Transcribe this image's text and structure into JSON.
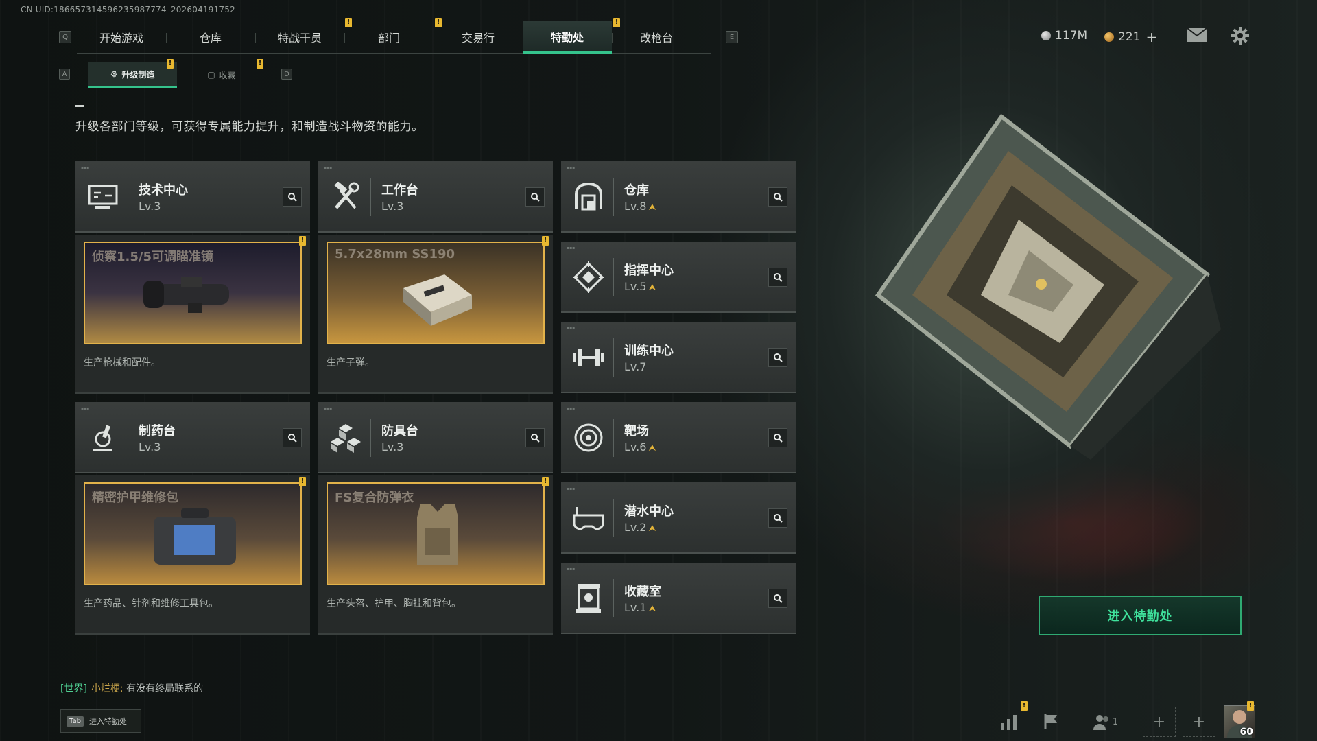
{
  "uid": "CN UID:18665731459623598777​4_202604191752",
  "nav": {
    "key_left": "Q",
    "key_right": "E",
    "tabs": [
      "开始游戏",
      "仓库",
      "特战干员",
      "部门",
      "交易行",
      "特勤处",
      "改枪台"
    ],
    "active": "特勤处"
  },
  "currency": {
    "silver": "117M",
    "gold": "221",
    "gold_add": "+"
  },
  "subnav": {
    "key_left": "A",
    "key_right": "D",
    "tabs": [
      "升级制造",
      "收藏"
    ],
    "active": "升级制造"
  },
  "description": "升级各部门等级，可获得专属能力提升，和制造战斗物资的能力。",
  "departments": [
    {
      "name": "技术中心",
      "level": "Lv.3",
      "upgradable": false,
      "icon": "monitor-icon"
    },
    {
      "name": "工作台",
      "level": "Lv.3",
      "upgradable": false,
      "icon": "wrench-hammer-icon"
    },
    {
      "name": "仓库",
      "level": "Lv.8",
      "upgradable": true,
      "icon": "warehouse-icon"
    },
    {
      "name": "指挥中心",
      "level": "Lv.5",
      "upgradable": true,
      "icon": "command-diamond-icon"
    },
    {
      "name": "训练中心",
      "level": "Lv.7",
      "upgradable": false,
      "icon": "dumbbell-icon"
    },
    {
      "name": "制药台",
      "level": "Lv.3",
      "upgradable": false,
      "icon": "microscope-icon"
    },
    {
      "name": "防具台",
      "level": "Lv.3",
      "upgradable": false,
      "icon": "cubes-icon"
    },
    {
      "name": "靶场",
      "level": "Lv.6",
      "upgradable": true,
      "icon": "target-icon"
    },
    {
      "name": "潜水中心",
      "level": "Lv.2",
      "upgradable": true,
      "icon": "diving-mask-icon"
    },
    {
      "name": "收藏室",
      "level": "Lv.1",
      "upgradable": true,
      "icon": "display-case-icon"
    }
  ],
  "productions": [
    {
      "item": "侦察1.5/5可调瞄准镜",
      "desc": "生产枪械和配件。"
    },
    {
      "item": "5.7x28mm SS190",
      "desc": "生产子弹。"
    },
    {
      "item": "精密护甲维修包",
      "desc": "生产药品、针剂和维修工具包。"
    },
    {
      "item": "FS复合防弹衣",
      "desc": "生产头盔、护甲、胸挂和背包。"
    }
  ],
  "enter_button": "进入特勤处",
  "chat": {
    "channel": "[世界]",
    "nick": "小烂梗:",
    "message": "有没有终局联系的"
  },
  "tab_hint": {
    "key": "Tab",
    "label": "进入特勤处"
  },
  "bottom": {
    "friends_count": "1",
    "player_level": "60"
  },
  "colors": {
    "accent": "#35c38c",
    "badge": "#e8b830",
    "gold_border": "#e2b24a"
  }
}
